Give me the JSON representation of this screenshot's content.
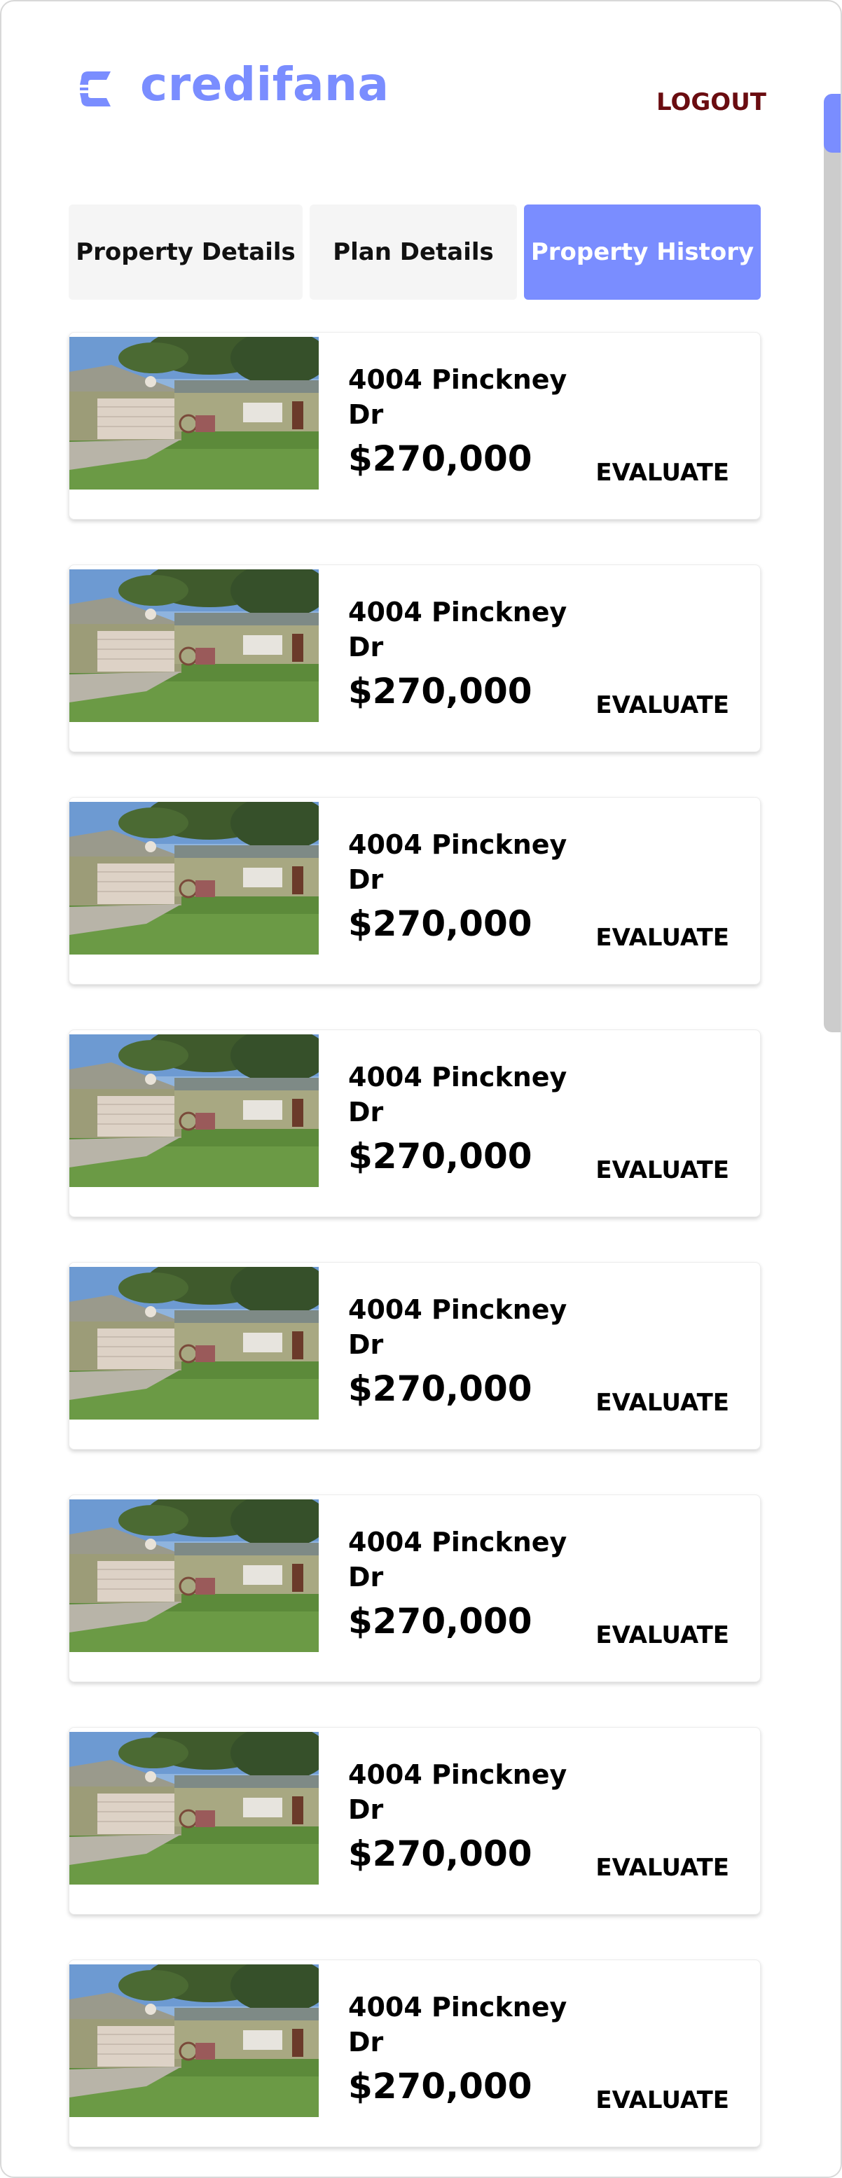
{
  "brand": {
    "name": "credifana",
    "accent_color": "#7a8dff",
    "logo_icon": "credifana-logo-icon"
  },
  "header": {
    "logout_label": "LOGOUT",
    "logout_color": "#6a0c10"
  },
  "tabs": [
    {
      "label": "Property Details",
      "active": false
    },
    {
      "label": "Plan Details",
      "active": false
    },
    {
      "label": "Property History",
      "active": true
    }
  ],
  "properties": [
    {
      "address": "4004 Pinckney Dr",
      "price": "$270,000",
      "action": "EVALUATE",
      "image": "house-photo"
    },
    {
      "address": "4004 Pinckney Dr",
      "price": "$270,000",
      "action": "EVALUATE",
      "image": "house-photo"
    },
    {
      "address": "4004 Pinckney Dr",
      "price": "$270,000",
      "action": "EVALUATE",
      "image": "house-photo"
    },
    {
      "address": "4004 Pinckney Dr",
      "price": "$270,000",
      "action": "EVALUATE",
      "image": "house-photo"
    },
    {
      "address": "4004 Pinckney Dr",
      "price": "$270,000",
      "action": "EVALUATE",
      "image": "house-photo"
    },
    {
      "address": "4004 Pinckney Dr",
      "price": "$270,000",
      "action": "EVALUATE",
      "image": "house-photo"
    },
    {
      "address": "4004 Pinckney Dr",
      "price": "$270,000",
      "action": "EVALUATE",
      "image": "house-photo"
    },
    {
      "address": "4004 Pinckney Dr",
      "price": "$270,000",
      "action": "EVALUATE",
      "image": "house-photo"
    }
  ]
}
